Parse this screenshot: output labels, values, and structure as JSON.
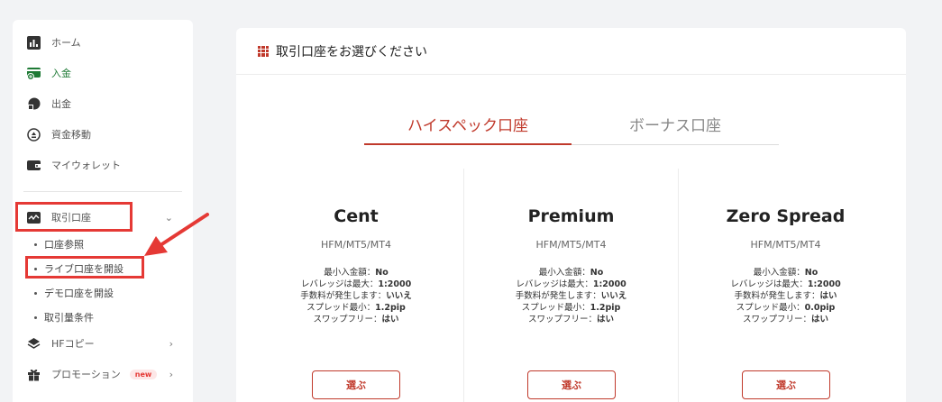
{
  "sidebar": {
    "home": "ホーム",
    "deposit": "入金",
    "withdraw": "出金",
    "transfer": "資金移動",
    "wallet": "マイウォレット",
    "trading_accounts": "取引口座",
    "sub_items": [
      "口座参照",
      "ライブ口座を開設",
      "デモ口座を開設",
      "取引量条件"
    ],
    "hf_copy": "HFコピー",
    "promotion": "プロモーション",
    "new_badge": "new"
  },
  "main": {
    "title": "取引口座をお選びください",
    "tabs": [
      "ハイスペック口座",
      "ボーナス口座"
    ]
  },
  "plans": [
    {
      "name": "Cent",
      "platform": "HFM/MT5/MT4",
      "min_deposit_label": "最小入金額：",
      "min_deposit": "No",
      "leverage_label": "レバレッジは最大：",
      "leverage": "1:2000",
      "commission_label": "手数料が発生します：",
      "commission": "いいえ",
      "spread_label": "スプレッド最小：",
      "spread": "1.2pip",
      "swap_label": "スワップフリー：",
      "swap": "はい",
      "button": "選ぶ"
    },
    {
      "name": "Premium",
      "platform": "HFM/MT5/MT4",
      "min_deposit_label": "最小入金額：",
      "min_deposit": "No",
      "leverage_label": "レバレッジは最大：",
      "leverage": "1:2000",
      "commission_label": "手数料が発生します：",
      "commission": "いいえ",
      "spread_label": "スプレッド最小：",
      "spread": "1.2pip",
      "swap_label": "スワップフリー：",
      "swap": "はい",
      "button": "選ぶ"
    },
    {
      "name": "Zero Spread",
      "platform": "HFM/MT5/MT4",
      "min_deposit_label": "最小入金額：",
      "min_deposit": "No",
      "leverage_label": "レバレッジは最大：",
      "leverage": "1:2000",
      "commission_label": "手数料が発生します：",
      "commission": "はい",
      "spread_label": "スプレッド最小：",
      "spread": "0.0pip",
      "swap_label": "スワップフリー：",
      "swap": "はい",
      "button": "選ぶ"
    }
  ],
  "colors": {
    "accent": "#c0392b",
    "highlight": "#e53935",
    "deposit_green": "#1e7a35"
  }
}
